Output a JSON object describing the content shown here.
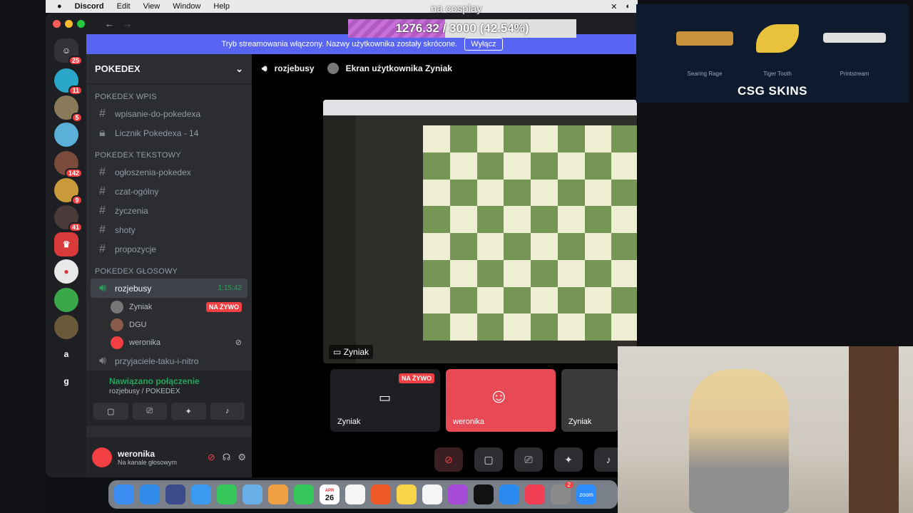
{
  "overlay": {
    "cosplay_text": "na cosplay",
    "progress_text": "1276.32 / 3000 (42.54%)",
    "progress_fraction": 0.4254
  },
  "menubar": {
    "app": "Discord",
    "items": [
      "Edit",
      "View",
      "Window",
      "Help"
    ]
  },
  "banner": {
    "text": "Tryb streamowania włączony. Nazwy użytkownika zostały skrócone.",
    "button": "Wyłącz"
  },
  "servers": [
    {
      "label": "",
      "badge": "25"
    },
    {
      "label": "",
      "badge": "11"
    },
    {
      "label": "",
      "badge": "5"
    },
    {
      "label": "",
      "badge": ""
    },
    {
      "label": "",
      "badge": "142"
    },
    {
      "label": "",
      "badge": "9"
    },
    {
      "label": "",
      "badge": "41"
    },
    {
      "label": "",
      "badge": ""
    },
    {
      "label": "",
      "badge": ""
    },
    {
      "label": "",
      "badge": ""
    },
    {
      "label": "",
      "badge": ""
    },
    {
      "label": "a",
      "badge": ""
    },
    {
      "label": "g",
      "badge": ""
    }
  ],
  "sidebar": {
    "guild_name": "POKEDEX",
    "categories": [
      {
        "name": "POKEDEX Wpis",
        "channels": [
          {
            "name": "wpisanie-do-pokedexa",
            "icon": "#"
          },
          {
            "name": "Licznik Pokedexa - 14",
            "icon": "lock"
          }
        ]
      },
      {
        "name": "POKEDEX Tekstowy",
        "channels": [
          {
            "name": "ogłoszenia-pokedex",
            "icon": "#"
          },
          {
            "name": "czat-ogólny",
            "icon": "#"
          },
          {
            "name": "życzenia",
            "icon": "#"
          },
          {
            "name": "shoty",
            "icon": "#"
          },
          {
            "name": "propozycje",
            "icon": "#"
          }
        ]
      },
      {
        "name": "POKEDEX GŁOSOWY",
        "channels": []
      }
    ],
    "voice_channel": {
      "name": "rozjebusy",
      "time": "1:15:42"
    },
    "voice_users": [
      {
        "name": "Zyniak",
        "live": "NA ŻYWO"
      },
      {
        "name": "DGU",
        "live": ""
      },
      {
        "name": "weronika",
        "live": ""
      }
    ],
    "next_channel": "przyjaciele-taku-i-nitro"
  },
  "voice_panel": {
    "status": "Nawiązano połączenie",
    "sub": "rozjebusy / POKEDEX"
  },
  "user_panel": {
    "name": "weronika",
    "status": "Na kanale głosowym"
  },
  "main": {
    "channel": "rozjebusy",
    "screen_title": "Ekran użytkownika Zyniak",
    "stream_label": "Zyniak",
    "tiles": [
      {
        "name": "Zyniak",
        "live": "NA ŻYWO",
        "color": "#1e1f22"
      },
      {
        "name": "weronika",
        "live": "",
        "color": "#e84a55"
      },
      {
        "name": "Zyniak",
        "live": "",
        "color": "#3a3a3a"
      }
    ]
  },
  "csgo": {
    "skins": [
      {
        "name": "Searing Rage"
      },
      {
        "name": "Tiger Tooth"
      },
      {
        "name": "Printstream"
      }
    ],
    "logo": "CSG SKINS"
  },
  "dock": {
    "calendar_month": "APR",
    "calendar_day": "26",
    "badge": "2",
    "zoom_label": "zoom"
  },
  "colors": {
    "accent": "#5865f2",
    "danger": "#f23f43",
    "online": "#23a55a"
  }
}
